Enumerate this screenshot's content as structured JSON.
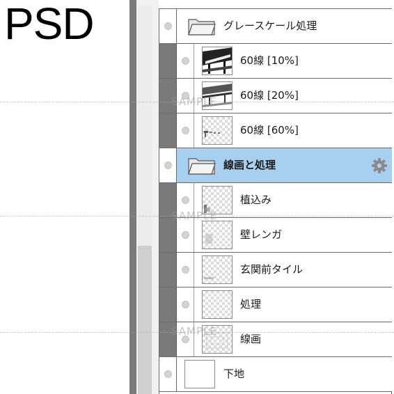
{
  "header": {
    "title": "PSD"
  },
  "watermark": {
    "text": "SAMPLE"
  },
  "layers": [
    {
      "name": "グレースケール処理",
      "kind": "folder",
      "selected": false
    },
    {
      "name": "60線 [10%]",
      "kind": "layer",
      "thumb": "photo-dark"
    },
    {
      "name": "60線 [20%]",
      "kind": "layer",
      "thumb": "photo-mid"
    },
    {
      "name": "60線 [60%]",
      "kind": "layer",
      "thumb": "photo-light"
    },
    {
      "name": "線画と処理",
      "kind": "folder",
      "selected": true,
      "icon": "gear-icon"
    },
    {
      "name": "植込み",
      "kind": "layer",
      "thumb": "transparent"
    },
    {
      "name": "壁レンガ",
      "kind": "layer",
      "thumb": "transparent"
    },
    {
      "name": "玄関前タイル",
      "kind": "layer",
      "thumb": "transparent"
    },
    {
      "name": "処理",
      "kind": "layer",
      "thumb": "transparent"
    },
    {
      "name": "線画",
      "kind": "layer",
      "thumb": "transparent"
    },
    {
      "name": "下地",
      "kind": "layer",
      "thumb": "white"
    }
  ],
  "colors": {
    "selected_row": "#a7cfef",
    "dark_rail": "#7a7a7a",
    "border": "#6b6b6b",
    "gear": "#8a8a8a"
  }
}
